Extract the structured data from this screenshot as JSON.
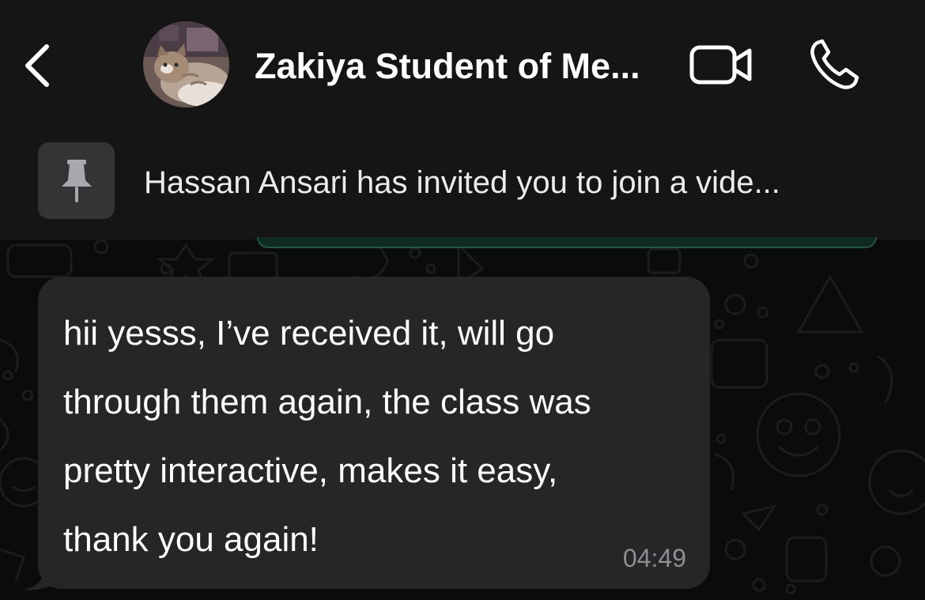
{
  "header": {
    "back_icon": "chevron-left-icon",
    "contact_name": "Zakiya Student of Me...",
    "avatar": "cat-photo-avatar",
    "video_icon": "video-camera-icon",
    "call_icon": "phone-icon"
  },
  "pinned": {
    "icon": "pin-icon",
    "text": "Hassan Ansari has invited you to join a vide..."
  },
  "message": {
    "lines": [
      "hii yesss, I’ve received it, will go",
      "through them again, the class was",
      "pretty interactive, makes it easy,",
      "thank you again!"
    ],
    "time": "04:49"
  },
  "colors": {
    "background": "#0b0b0b",
    "header": "#151515",
    "bubble_incoming": "#262626",
    "pin_box": "#343437",
    "timestamp": "#8e8e93",
    "accent_green": "#1e5a43"
  }
}
